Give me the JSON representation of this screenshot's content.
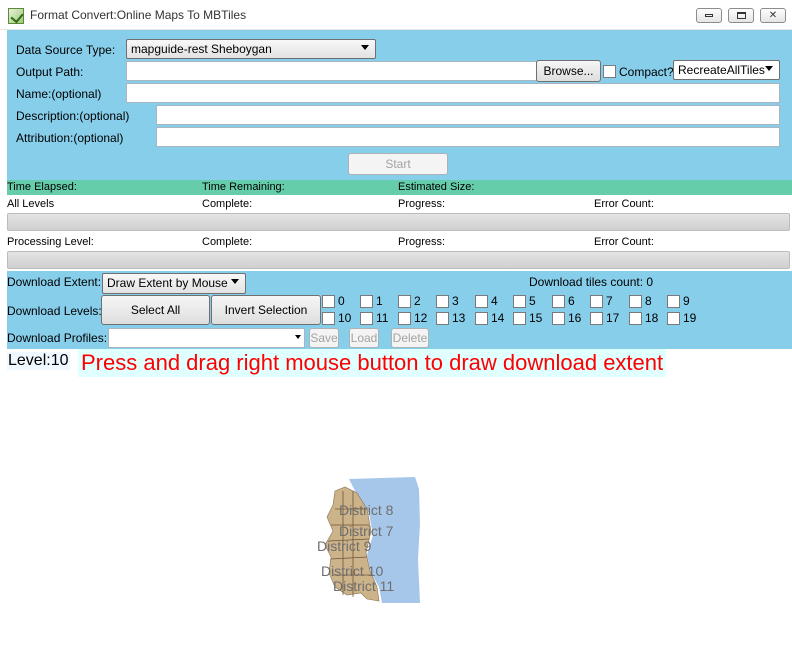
{
  "window": {
    "title": "Format Convert:Online Maps To MBTiles",
    "buttons": {
      "minimize": "minimize",
      "maximize": "maximize",
      "close": "✕"
    }
  },
  "config": {
    "data_source_label": "Data Source Type:",
    "data_source_value": "mapguide-rest Sheboygan",
    "output_path_label": "Output Path:",
    "output_path_value": "",
    "browse_label": "Browse...",
    "compact_label": "Compact?",
    "compact_checked": false,
    "mode_value": "RecreateAllTiles",
    "name_label": "Name:(optional)",
    "name_value": "",
    "description_label": "Description:(optional)",
    "description_value": "",
    "attribution_label": "Attribution:(optional)",
    "attribution_value": "",
    "start_label": "Start"
  },
  "status": {
    "time_elapsed": "Time Elapsed:",
    "time_remaining": "Time Remaining:",
    "estimated_size": "Estimated Size:"
  },
  "progress": {
    "all_levels": "All Levels",
    "complete": "Complete:",
    "progress": "Progress:",
    "error_count": "Error Count:",
    "processing_level": "Processing Level:",
    "all_levels_fill": 0,
    "processing_level_fill": 0
  },
  "download": {
    "extent_label": "Download Extent:",
    "extent_value": "Draw Extent by Mouse",
    "tiles_count": "Download tiles count: 0",
    "levels_label": "Download Levels:",
    "select_all": "Select All",
    "invert_selection": "Invert Selection",
    "levels": [
      "0",
      "1",
      "2",
      "3",
      "4",
      "5",
      "6",
      "7",
      "8",
      "9",
      "10",
      "11",
      "12",
      "13",
      "14",
      "15",
      "16",
      "17",
      "18",
      "19"
    ],
    "profiles_label": "Download Profiles:",
    "profiles_value": "",
    "save_label": "Save",
    "load_label": "Load",
    "delete_label": "Delete"
  },
  "map": {
    "level": "Level:10",
    "hint": "Press and drag right mouse button to draw download extent",
    "districts": [
      "District 8",
      "District 7",
      "District 9",
      "District 10",
      "District 11"
    ],
    "colors": {
      "water": "#a7c7ea",
      "land": "#cdb38a",
      "panel": "#87ceeb",
      "strip": "#66cdaa"
    }
  }
}
